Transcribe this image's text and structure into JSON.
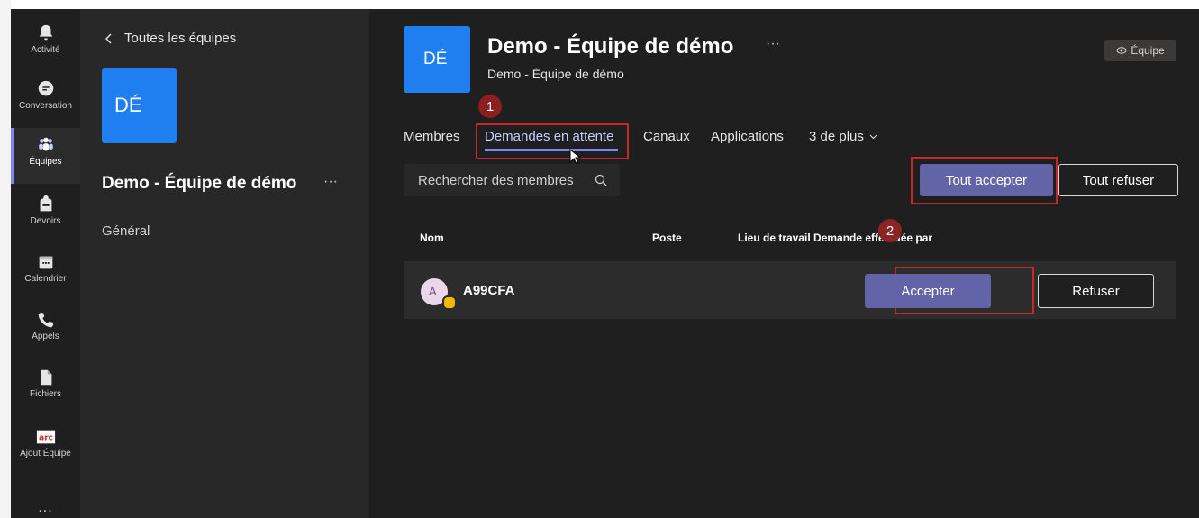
{
  "rail": {
    "items": [
      {
        "label": "Activité",
        "icon": "bell-icon",
        "active": false
      },
      {
        "label": "Conversation",
        "icon": "chat-icon",
        "active": false
      },
      {
        "label": "Équipes",
        "icon": "teams-icon",
        "active": true
      },
      {
        "label": "Devoirs",
        "icon": "backpack-icon",
        "active": false
      },
      {
        "label": "Calendrier",
        "icon": "calendar-icon",
        "active": false
      },
      {
        "label": "Appels",
        "icon": "phone-icon",
        "active": false
      },
      {
        "label": "Fichiers",
        "icon": "file-icon",
        "active": false
      },
      {
        "label": "Ajout Équipe",
        "icon": "arc-logo-icon",
        "active": false
      }
    ],
    "more": "..."
  },
  "team_panel": {
    "back_label": "Toutes les équipes",
    "avatar_initials": "DÉ",
    "team_name": "Demo - Équipe de démo",
    "more": "···",
    "channel_general": "Général"
  },
  "header": {
    "avatar_initials": "DÉ",
    "title": "Demo - Équipe de démo",
    "title_more": "···",
    "subtitle": "Demo - Équipe de démo",
    "team_badge": "Équipe"
  },
  "steps": {
    "one": "1",
    "two": "2"
  },
  "tabs": [
    {
      "label": "Membres"
    },
    {
      "label": "Demandes en attente"
    },
    {
      "label": "Canaux"
    },
    {
      "label": "Applications"
    },
    {
      "label": "3 de plus"
    }
  ],
  "search": {
    "placeholder": "Rechercher des membres"
  },
  "actions": {
    "accept_all": "Tout accepter",
    "reject_all": "Tout refuser"
  },
  "table": {
    "headers": {
      "nom": "Nom",
      "poste": "Poste",
      "lieu": "Lieu de travail Demande effectuée par"
    },
    "rows": [
      {
        "initial": "A",
        "name": "A99CFA",
        "accept": "Accepter",
        "reject": "Refuser"
      }
    ]
  },
  "colors": {
    "accent": "#6264a7",
    "highlight": "#c4282a",
    "team_avatar": "#1f7ff0",
    "pending_badge": "#f5b800"
  }
}
